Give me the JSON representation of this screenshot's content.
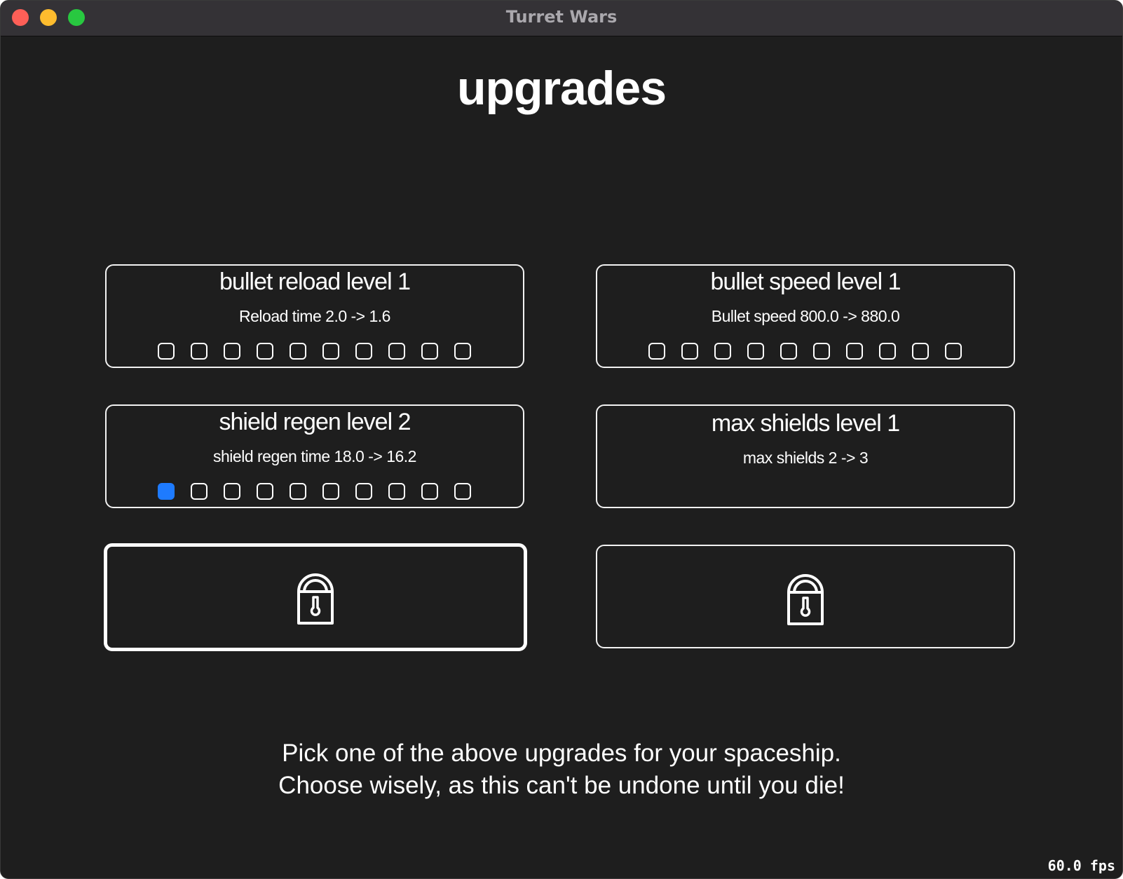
{
  "window": {
    "title": "Turret Wars",
    "controls": [
      "close",
      "minimize",
      "maximize"
    ],
    "control_colors": {
      "close": "#fe5f57",
      "minimize": "#febc2e",
      "maximize": "#28c840"
    }
  },
  "page": {
    "title": "upgrades"
  },
  "accent_color": "#1e7bff",
  "upgrades": [
    {
      "title": "bullet reload level 1",
      "description": "Reload time 2.0 -> 1.6",
      "pips_filled": 0,
      "pips_total": 10
    },
    {
      "title": "bullet speed level 1",
      "description": "Bullet speed 800.0 -> 880.0",
      "pips_filled": 0,
      "pips_total": 10
    },
    {
      "title": "shield regen level 2",
      "description": "shield regen time 18.0 -> 16.2",
      "pips_filled": 1,
      "pips_total": 10
    },
    {
      "title": "max shields level 1",
      "description": "max shields 2 -> 3",
      "pips_filled": 0,
      "pips_total": 0
    }
  ],
  "locked_slots": [
    {
      "icon": "lock-icon",
      "selected": true
    },
    {
      "icon": "lock-icon",
      "selected": false
    }
  ],
  "footer": {
    "line1": "Pick one of the above upgrades for your spaceship.",
    "line2": "Choose wisely, as this can't be undone until you die!"
  },
  "status": {
    "fps": "60.0 fps"
  }
}
